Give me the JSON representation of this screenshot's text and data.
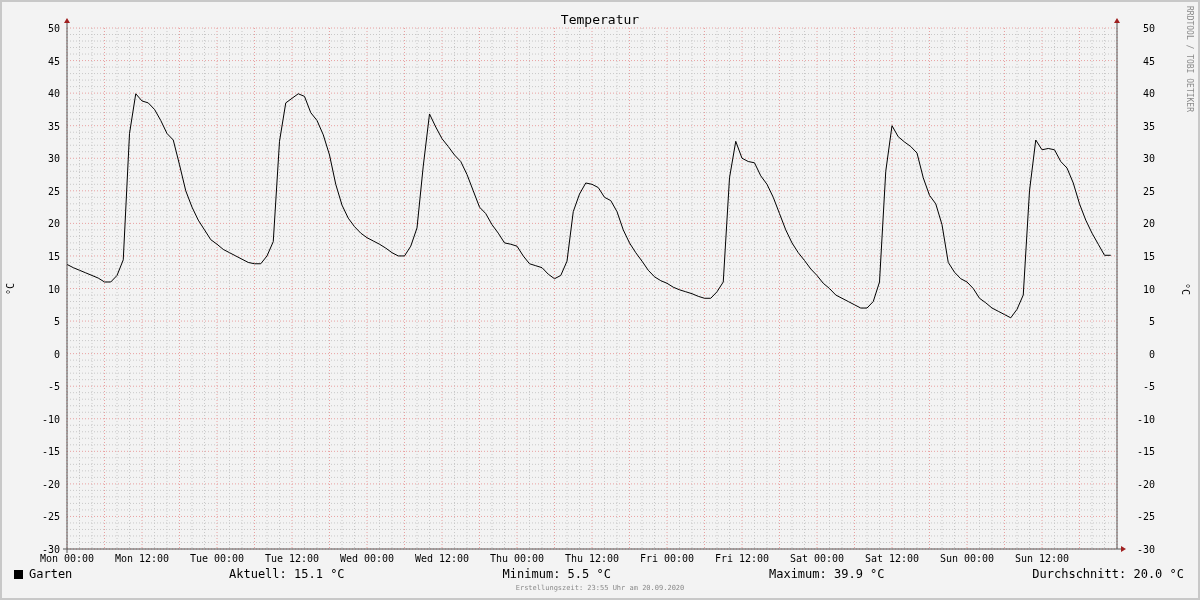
{
  "chart": {
    "chart_data": {
      "type": "line",
      "title": "Temperatur",
      "ylabel": "°C",
      "categories": [
        "Mon 00:00",
        null,
        null,
        null,
        null,
        null,
        null,
        null,
        null,
        null,
        null,
        null,
        "Mon 12:00",
        null,
        null,
        null,
        null,
        null,
        null,
        null,
        null,
        null,
        null,
        null,
        "Tue 00:00",
        null,
        null,
        null,
        null,
        null,
        null,
        null,
        null,
        null,
        null,
        null,
        "Tue 12:00",
        null,
        null,
        null,
        null,
        null,
        null,
        null,
        null,
        null,
        null,
        null,
        "Wed 00:00",
        null,
        null,
        null,
        null,
        null,
        null,
        null,
        null,
        null,
        null,
        null,
        "Wed 12:00",
        null,
        null,
        null,
        null,
        null,
        null,
        null,
        null,
        null,
        null,
        null,
        "Thu 00:00",
        null,
        null,
        null,
        null,
        null,
        null,
        null,
        null,
        null,
        null,
        null,
        "Thu 12:00",
        null,
        null,
        null,
        null,
        null,
        null,
        null,
        null,
        null,
        null,
        null,
        "Fri 00:00",
        null,
        null,
        null,
        null,
        null,
        null,
        null,
        null,
        null,
        null,
        null,
        "Fri 12:00",
        null,
        null,
        null,
        null,
        null,
        null,
        null,
        null,
        null,
        null,
        null,
        "Sat 00:00",
        null,
        null,
        null,
        null,
        null,
        null,
        null,
        null,
        null,
        null,
        null,
        "Sat 12:00",
        null,
        null,
        null,
        null,
        null,
        null,
        null,
        null,
        null,
        null,
        null,
        "Sun 00:00",
        null,
        null,
        null,
        null,
        null,
        null,
        null,
        null,
        null,
        null,
        null,
        "Sun 12:00",
        null,
        null,
        null,
        null,
        null,
        null,
        null,
        null,
        null,
        null,
        null
      ],
      "series": [
        {
          "name": "Garten",
          "color": "#000000",
          "values": [
            13.7,
            13.2,
            12.8,
            12.4,
            12,
            11.6,
            11,
            11,
            12,
            14.4,
            33.8,
            39.9,
            38.8,
            38.5,
            37.5,
            35.8,
            33.8,
            32.8,
            29,
            25,
            22.5,
            20.5,
            19,
            17.5,
            16.8,
            16,
            15.5,
            15,
            14.5,
            14,
            13.8,
            13.8,
            15,
            17.2,
            32.6,
            38.5,
            39.2,
            39.9,
            39.5,
            37,
            35.8,
            33.6,
            30.5,
            26,
            22.8,
            20.8,
            19.5,
            18.5,
            17.8,
            17.3,
            16.8,
            16.2,
            15.5,
            15,
            15,
            16.5,
            19.3,
            28.8,
            36.8,
            34.8,
            33,
            31.8,
            30.5,
            29.5,
            27.5,
            25,
            22.5,
            21.5,
            19.8,
            18.5,
            17,
            16.8,
            16.5,
            15,
            13.8,
            13.5,
            13.2,
            12.2,
            11.5,
            12,
            14.2,
            21.8,
            24.5,
            26.2,
            26,
            25.5,
            24,
            23.5,
            21.8,
            19,
            17,
            15.5,
            14.2,
            12.8,
            11.8,
            11.2,
            10.8,
            10.2,
            9.8,
            9.5,
            9.2,
            8.8,
            8.5,
            8.5,
            9.5,
            11,
            27,
            32.6,
            30,
            29.5,
            29.3,
            27.3,
            26,
            24,
            21.5,
            19,
            17,
            15.5,
            14.3,
            13,
            12,
            10.8,
            10,
            9,
            8.5,
            8,
            7.5,
            7,
            7,
            8,
            11,
            28,
            35,
            33.3,
            32.5,
            31.8,
            30.8,
            27,
            24.3,
            23,
            19.8,
            14,
            12.5,
            11.5,
            11,
            10,
            8.5,
            7.8,
            7,
            6.5,
            6,
            5.5,
            6.8,
            9,
            25,
            32.8,
            31.3,
            31.5,
            31.3,
            29.5,
            28.5,
            26.2,
            23,
            20.5,
            18.5,
            16.8,
            15.1,
            15.1
          ]
        }
      ],
      "ylim": [
        -30,
        50
      ],
      "grid": true,
      "yticks": [
        -30,
        -25,
        -20,
        -15,
        -10,
        -5,
        0,
        5,
        10,
        15,
        20,
        25,
        30,
        35,
        40,
        45,
        50
      ]
    },
    "right_ylabel": "°C",
    "right_yticks": [
      "50",
      "45",
      "40",
      "35",
      "30",
      "25",
      "20",
      "15",
      "10",
      "5",
      "0",
      "-5",
      "-10",
      "-15",
      "-20",
      "-25",
      "-30"
    ],
    "credit": "RRDTOOL / TOBI OETIKER"
  },
  "stats": [
    "Aktuell: 15.1 °C",
    "Minimum: 5.5 °C",
    "Maximum: 39.9 °C",
    "Durchschnitt: 20.0 °C"
  ],
  "footer": "Erstellungszeit: 23:55 Uhr am 20.09.2020"
}
